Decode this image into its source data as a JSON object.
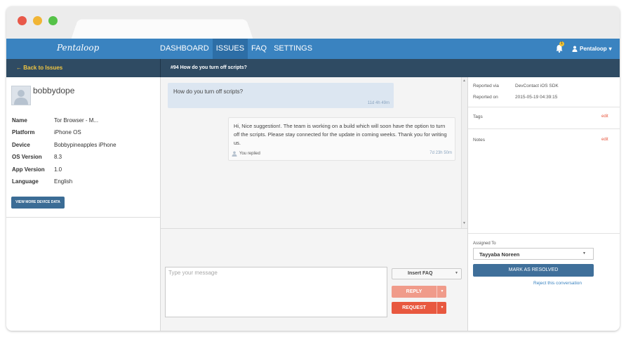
{
  "window": {
    "dot_colors": [
      "#e8594a",
      "#f1b535",
      "#55c248"
    ]
  },
  "topbar": {
    "brand": "Pentaloop",
    "nav": [
      "DASHBOARD",
      "ISSUES",
      "FAQ",
      "SETTINGS"
    ],
    "active_nav": "ISSUES",
    "notification_count": "1",
    "user": "Pentaloop",
    "user_caret": "▾"
  },
  "subbar": {
    "back_label": "← Back to Issues",
    "ticket_title": "#94 How do you turn off scripts?"
  },
  "profile": {
    "username": "bobbydope",
    "fields": [
      {
        "label": "Name",
        "value": "Tor Browser - M..."
      },
      {
        "label": "Platform",
        "value": "iPhone OS"
      },
      {
        "label": "Device",
        "value": "Bobbypineapples iPhone"
      },
      {
        "label": "OS Version",
        "value": "8.3"
      },
      {
        "label": "App Version",
        "value": "1.0"
      },
      {
        "label": "Language",
        "value": "English"
      }
    ],
    "view_more_label": "VIEW MORE DEVICE DATA"
  },
  "conversation": {
    "question": {
      "text": "How do you turn off scripts?",
      "time": "11d 4h 49m"
    },
    "reply": {
      "text": "Hi, Nice suggestion!. The team is working on a build which will soon have the option to turn off the scripts. Please stay connected for the update in coming weeks. Thank you for writing us.",
      "author": "You replied",
      "time": "7d 23h 50m"
    }
  },
  "composer": {
    "placeholder": "Type your message",
    "insert_faq_label": "Insert FAQ",
    "reply_label": "REPLY",
    "request_label": "REQUEST"
  },
  "details": {
    "reported_via_label": "Reported via",
    "reported_via_value": "DevContact iOS SDK",
    "reported_on_label": "Reported on",
    "reported_on_value": "2015-05-19 04:39:15",
    "tags_label": "Tags",
    "notes_label": "Notes",
    "edit_label": "edit",
    "assigned_to_label": "Assigned To",
    "assignee": "Tayyaba Noreen",
    "resolve_label": "MARK AS RESOLVED",
    "reject_label": "Reject this conversation"
  }
}
